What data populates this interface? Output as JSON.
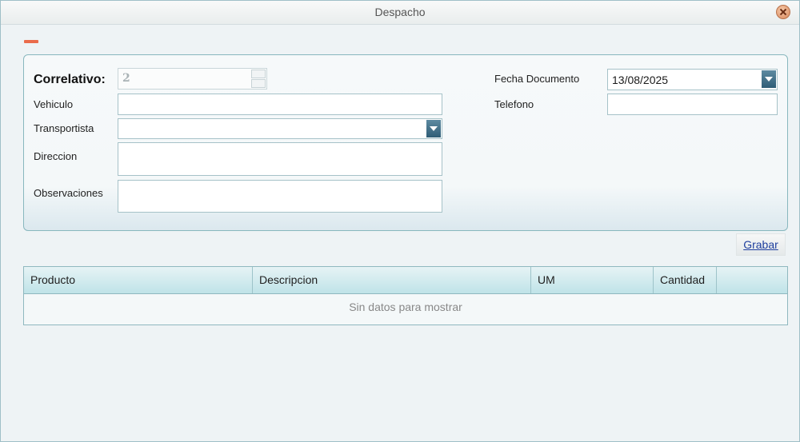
{
  "window": {
    "title": "Despacho"
  },
  "form": {
    "correlativo_label": "Correlativo:",
    "correlativo_value": "2",
    "vehiculo_label": "Vehiculo",
    "vehiculo_value": "",
    "transportista_label": "Transportista",
    "transportista_value": "",
    "direccion_label": "Direccion",
    "direccion_value": "",
    "observaciones_label": "Observaciones",
    "observaciones_value": "",
    "fecha_label": "Fecha Documento",
    "fecha_value": "13/08/2025",
    "telefono_label": "Telefono",
    "telefono_value": ""
  },
  "actions": {
    "save_label": "Grabar"
  },
  "grid": {
    "columns": [
      "Producto",
      "Descripcion",
      "UM",
      "Cantidad",
      ""
    ],
    "empty_text": "Sin datos para mostrar"
  },
  "colors": {
    "accent": "#2f5d76",
    "border": "#88b7be",
    "close": "#d7865a",
    "minimize": "#ea6b4b"
  }
}
